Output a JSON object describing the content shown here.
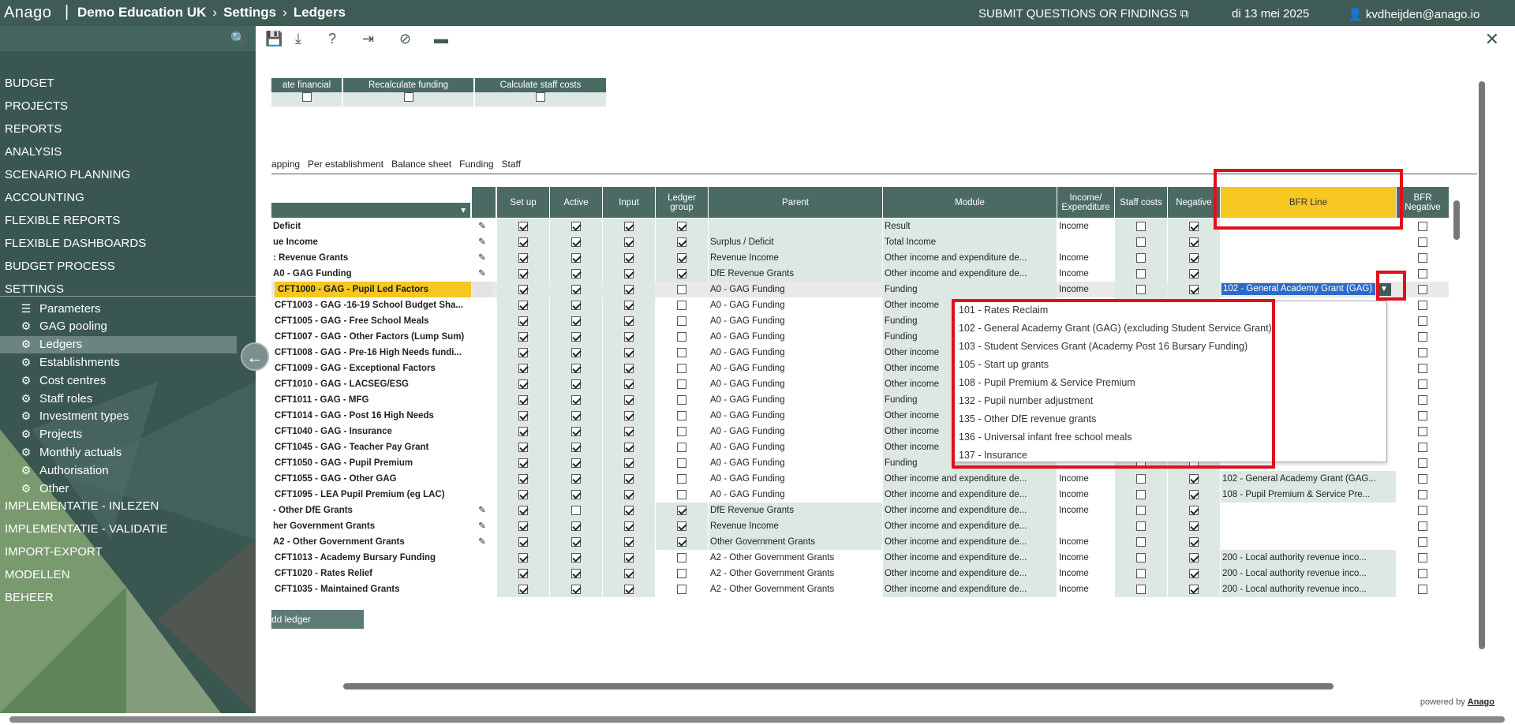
{
  "topbar": {
    "logo": "Anago",
    "breadcrumb": [
      "Demo Education UK",
      "Settings",
      "Ledgers"
    ],
    "submit": "SUBMIT QUESTIONS OR FINDINGS",
    "date": "di 13 mei 2025",
    "user": "kvdheijden@anago.io"
  },
  "sidebar": {
    "menu": [
      "BUDGET",
      "PROJECTS",
      "REPORTS",
      "ANALYSIS",
      "SCENARIO PLANNING",
      "ACCOUNTING",
      "FLEXIBLE REPORTS",
      "FLEXIBLE DASHBOARDS",
      "BUDGET PROCESS",
      "SETTINGS"
    ],
    "submenu": [
      "Parameters",
      "GAG pooling",
      "Ledgers",
      "Establishments",
      "Cost centres",
      "Staff roles",
      "Investment types",
      "Projects",
      "Monthly actuals",
      "Authorisation",
      "Other"
    ],
    "menu_bottom": [
      "IMPLEMENTATIE - INLEZEN",
      "IMPLEMENTATIE - VALIDATIE",
      "IMPORT-EXPORT",
      "MODELLEN",
      "BEHEER"
    ]
  },
  "recalc": {
    "headers": [
      "ate financial",
      "Recalculate funding",
      "Calculate staff costs"
    ]
  },
  "tabs": [
    "apping",
    "Per establishment",
    "Balance sheet",
    "Funding",
    "Staff"
  ],
  "grid": {
    "headers": [
      "Set up",
      "Active",
      "Input",
      "Ledger group",
      "Parent",
      "Module",
      "Income/ Expenditure",
      "Staff costs",
      "Negative",
      "BFR Line",
      "BFR Negative"
    ],
    "rows": [
      {
        "name": "Deficit",
        "parent": "",
        "module": "Result",
        "ie": "Income",
        "bfr": "",
        "edit": true,
        "sub": false,
        "lg": true,
        "act": true,
        "neg": true
      },
      {
        "name": "ue Income",
        "parent": "Surplus / Deficit",
        "module": "Total Income",
        "ie": "",
        "bfr": "",
        "edit": true,
        "sub": false,
        "lg": true,
        "act": true,
        "neg": true
      },
      {
        "name": ": Revenue Grants",
        "parent": "Revenue Income",
        "module": "Other income and expenditure de...",
        "ie": "Income",
        "bfr": "",
        "edit": true,
        "sub": false,
        "lg": true,
        "act": true,
        "neg": true
      },
      {
        "name": "A0 - GAG Funding",
        "parent": "DfE Revenue Grants",
        "module": "Other income and expenditure de...",
        "ie": "Income",
        "bfr": "",
        "edit": true,
        "sub": false,
        "lg": true,
        "act": true,
        "neg": true
      },
      {
        "name": "CFT1000 - GAG - Pupil Led Factors",
        "parent": "A0 - GAG Funding",
        "module": "Funding",
        "ie": "Income",
        "bfr": "102 - General Academy Grant (GAG)",
        "edit": false,
        "sub": true,
        "lg": false,
        "act": true,
        "neg": true,
        "hl": true
      },
      {
        "name": "CFT1003 - GAG -16-19 School Budget Sha...",
        "parent": "A0 - GAG Funding",
        "module": "Other income",
        "ie": "",
        "bfr": "",
        "sub": true,
        "lg": false,
        "act": true,
        "neg": false
      },
      {
        "name": "CFT1005 - GAG - Free School Meals",
        "parent": "A0 - GAG Funding",
        "module": "Funding",
        "ie": "",
        "bfr": "",
        "sub": true,
        "lg": false,
        "act": true,
        "neg": false
      },
      {
        "name": "CFT1007 - GAG - Other Factors (Lump Sum)",
        "parent": "A0 - GAG Funding",
        "module": "Funding",
        "ie": "",
        "bfr": "",
        "sub": true,
        "lg": false,
        "act": true,
        "neg": false
      },
      {
        "name": "CFT1008 - GAG - Pre-16 High Needs fundi...",
        "parent": "A0 - GAG Funding",
        "module": "Other income",
        "ie": "",
        "bfr": "",
        "sub": true,
        "lg": false,
        "act": true,
        "neg": false
      },
      {
        "name": "CFT1009 - GAG - Exceptional Factors",
        "parent": "A0 - GAG Funding",
        "module": "Other income",
        "ie": "",
        "bfr": "",
        "sub": true,
        "lg": false,
        "act": true,
        "neg": false
      },
      {
        "name": "CFT1010 - GAG - LACSEG/ESG",
        "parent": "A0 - GAG Funding",
        "module": "Other income",
        "ie": "",
        "bfr": "",
        "sub": true,
        "lg": false,
        "act": true,
        "neg": false
      },
      {
        "name": "CFT1011 - GAG - MFG",
        "parent": "A0 - GAG Funding",
        "module": "Funding",
        "ie": "",
        "bfr": "",
        "sub": true,
        "lg": false,
        "act": true,
        "neg": false
      },
      {
        "name": "CFT1014 - GAG - Post 16 High Needs",
        "parent": "A0 - GAG Funding",
        "module": "Other income",
        "ie": "",
        "bfr": "",
        "sub": true,
        "lg": false,
        "act": true,
        "neg": false
      },
      {
        "name": "CFT1040 - GAG - Insurance",
        "parent": "A0 - GAG Funding",
        "module": "Other income",
        "ie": "",
        "bfr": "",
        "sub": true,
        "lg": false,
        "act": true,
        "neg": false
      },
      {
        "name": "CFT1045 - GAG - Teacher Pay Grant",
        "parent": "A0 - GAG Funding",
        "module": "Other income",
        "ie": "",
        "bfr": "",
        "sub": true,
        "lg": false,
        "act": true,
        "neg": false
      },
      {
        "name": "CFT1050 - GAG - Pupil Premium",
        "parent": "A0 - GAG Funding",
        "module": "Funding",
        "ie": "",
        "bfr": "",
        "sub": true,
        "lg": false,
        "act": true,
        "neg": false
      },
      {
        "name": "CFT1055 - GAG - Other GAG",
        "parent": "A0 - GAG Funding",
        "module": "Other income and expenditure de...",
        "ie": "Income",
        "bfr": "102 - General Academy Grant (GAG...",
        "sub": true,
        "lg": false,
        "act": true,
        "neg": true
      },
      {
        "name": "CFT1095 - LEA Pupil Premium (eg LAC)",
        "parent": "A0 - GAG Funding",
        "module": "Other income and expenditure de...",
        "ie": "Income",
        "bfr": "108 - Pupil Premium & Service Pre...",
        "sub": true,
        "lg": false,
        "act": true,
        "neg": true
      },
      {
        "name": "- Other DfE Grants",
        "parent": "DfE Revenue Grants",
        "module": "Other income and expenditure de...",
        "ie": "Income",
        "bfr": "",
        "edit": true,
        "sub": false,
        "lg": true,
        "act": false,
        "neg": true
      },
      {
        "name": "her Government Grants",
        "parent": "Revenue Income",
        "module": "Other income and expenditure de...",
        "ie": "",
        "bfr": "",
        "edit": true,
        "sub": false,
        "lg": true,
        "act": true,
        "neg": true
      },
      {
        "name": "A2 - Other Government Grants",
        "parent": "Other Government Grants",
        "module": "Other income and expenditure de...",
        "ie": "Income",
        "bfr": "",
        "edit": true,
        "sub": false,
        "lg": true,
        "act": true,
        "neg": true
      },
      {
        "name": "CFT1013 - Academy Bursary Funding",
        "parent": "A2 - Other Government Grants",
        "module": "Other income and expenditure de...",
        "ie": "Income",
        "bfr": "200 - Local authority revenue inco...",
        "sub": true,
        "lg": false,
        "act": true,
        "neg": true
      },
      {
        "name": "CFT1020 - Rates Relief",
        "parent": "A2 - Other Government Grants",
        "module": "Other income and expenditure de...",
        "ie": "Income",
        "bfr": "200 - Local authority revenue inco...",
        "sub": true,
        "lg": false,
        "act": true,
        "neg": true
      },
      {
        "name": "CFT1035 - Maintained Grants",
        "parent": "A2 - Other Government Grants",
        "module": "Other income and expenditure de...",
        "ie": "Income",
        "bfr": "200 - Local authority revenue inco...",
        "sub": true,
        "lg": false,
        "act": true,
        "neg": true
      }
    ]
  },
  "dropdown": {
    "options": [
      "101 - Rates Reclaim",
      "102 - General Academy Grant (GAG) (excluding Student Service Grant)",
      "103 - Student Services Grant (Academy Post 16 Bursary Funding)",
      "105 - Start up grants",
      "108 - Pupil Premium & Service Premium",
      "132 - Pupil number adjustment",
      "135 - Other DfE revenue grants",
      "136 - Universal infant free school meals",
      "137 - Insurance"
    ]
  },
  "add_ledger": "dd ledger",
  "footer": {
    "powered": "powered by",
    "brand": "Anago"
  },
  "colors": {
    "header": "#3f5b56",
    "accent": "#f5c720",
    "highlight": "#e0101a"
  }
}
